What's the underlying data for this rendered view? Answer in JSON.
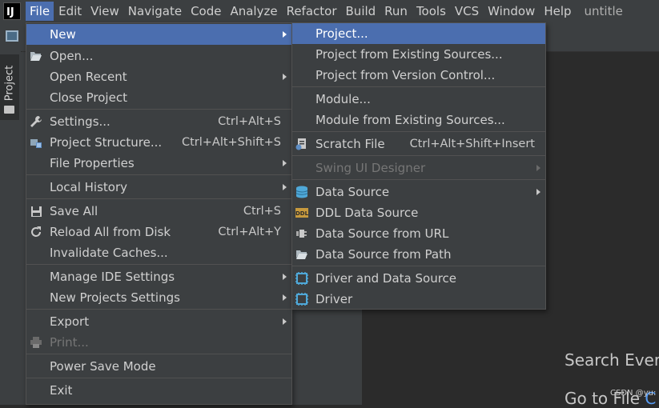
{
  "menubar": {
    "logo": "IJ",
    "items": [
      "File",
      "Edit",
      "View",
      "Navigate",
      "Code",
      "Analyze",
      "Refactor",
      "Build",
      "Run",
      "Tools",
      "VCS",
      "Window",
      "Help"
    ],
    "window_title": "untitle"
  },
  "left_stripe": {
    "project_tab": "Project"
  },
  "file_menu": {
    "new": "New",
    "open": "Open...",
    "open_recent": "Open Recent",
    "close_project": "Close Project",
    "settings": "Settings...",
    "settings_shortcut": "Ctrl+Alt+S",
    "project_structure": "Project Structure...",
    "project_structure_shortcut": "Ctrl+Alt+Shift+S",
    "file_properties": "File Properties",
    "local_history": "Local History",
    "save_all": "Save All",
    "save_all_shortcut": "Ctrl+S",
    "reload_all": "Reload All from Disk",
    "reload_all_shortcut": "Ctrl+Alt+Y",
    "invalidate_caches": "Invalidate Caches...",
    "manage_ide_settings": "Manage IDE Settings",
    "new_projects_settings": "New Projects Settings",
    "export": "Export",
    "print": "Print...",
    "power_save_mode": "Power Save Mode",
    "exit": "Exit"
  },
  "new_submenu": {
    "project": "Project...",
    "project_existing": "Project from Existing Sources...",
    "project_vcs": "Project from Version Control...",
    "module": "Module...",
    "module_existing": "Module from Existing Sources...",
    "scratch_file": "Scratch File",
    "scratch_file_shortcut": "Ctrl+Alt+Shift+Insert",
    "swing_ui_designer": "Swing UI Designer",
    "data_source": "Data Source",
    "ddl_data_source": "DDL Data Source",
    "data_source_url": "Data Source from URL",
    "data_source_path": "Data Source from Path",
    "driver_and_data_source": "Driver and Data Source",
    "driver": "Driver"
  },
  "welcome": {
    "search": "Search Every",
    "goto": "Go to File",
    "goto_key": "C"
  },
  "watermark": "CSDN @yu:",
  "colors": {
    "highlight": "#4b6eaf",
    "menu_bg": "#3c3f41",
    "editor_bg": "#2b2b2b",
    "link": "#589df6"
  }
}
